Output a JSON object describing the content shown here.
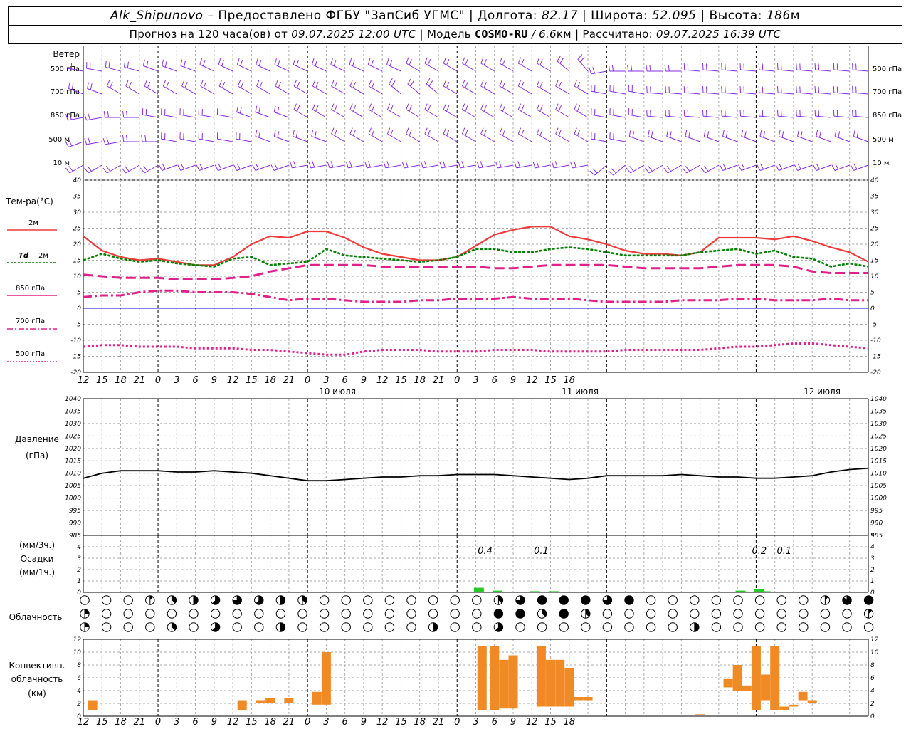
{
  "header": {
    "station": "Alk_Shipunovo",
    "provider": " – Предоставлено ФГБУ \"ЗапСиб УГМС\" | Долгота: ",
    "lon": "82.17",
    "lat_label": " | Широта: ",
    "lat": "52.095",
    "alt_label": " | Высота: ",
    "alt": "186",
    "alt_unit": "м",
    "fc_label": "Прогноз на 120 часа(ов) от ",
    "fc_time": "09.07.2025 12:00 UTC",
    "model_label": " | Модель ",
    "model": "COSMO-RU",
    "model_res": " / 6.6",
    "model_res_unit": "км",
    "calc_label": " | Рассчитано: ",
    "calc_time": "09.07.2025 16:39 UTC"
  },
  "wind_panel": {
    "title": "Ветер",
    "levels": [
      "500 гПа",
      "700 гПа",
      "850 гПа",
      "500 м",
      "10 м"
    ],
    "color": "#8a2be2"
  },
  "hour_ticks": [
    "12",
    "15",
    "18",
    "21",
    "0",
    "3",
    "6",
    "9",
    "12",
    "15",
    "18",
    "21",
    "0",
    "3",
    "6",
    "9",
    "12",
    "15",
    "18",
    "21",
    "0",
    "3",
    "6",
    "9",
    "12",
    "15",
    "18"
  ],
  "day_labels": [
    "10 июля",
    "11 июля",
    "12 июля"
  ],
  "legend": {
    "title": "Тем-ра(°C)",
    "t2m": "2м",
    "td_prefix": "Td",
    "td": "2м",
    "t850": "850 гПа",
    "t700": "700 гПа",
    "t500": "500 гПа"
  },
  "pressure_panel": {
    "title": "Давление",
    "unit": "(гПа)"
  },
  "precip_panel": {
    "unit3": "(мм/3ч.)",
    "title": "Осадки",
    "unit1": "(мм/1ч.)"
  },
  "cloud_panel": {
    "title": "Облачность"
  },
  "conv_panel": {
    "title1": "Конвективн.",
    "title2": "облачность",
    "unit": "(км)"
  },
  "colors": {
    "t2m": "#ee3b3b",
    "td": "#008000",
    "t850": "#e0218a",
    "t700": "#e0218a",
    "t500": "#e0218a",
    "zero": "#0000cd",
    "pressure": "#000000",
    "precip": "#22cc22",
    "conv": "#f08a24"
  },
  "chart_data": [
    {
      "type": "line",
      "title": "Тем-ра(°C)",
      "x_hours": [
        0,
        3,
        6,
        9,
        12,
        15,
        18,
        21,
        24,
        27,
        30,
        33,
        36,
        39,
        42,
        45,
        48,
        51,
        54,
        57,
        60,
        63,
        66,
        69,
        72,
        75,
        78,
        81,
        84,
        87,
        90,
        93,
        96,
        99,
        102,
        105,
        108,
        111,
        114,
        117,
        120,
        123,
        126
      ],
      "ylim": [
        -20,
        40
      ],
      "series": [
        {
          "name": "2м",
          "values": [
            22.5,
            18,
            16,
            15,
            15.5,
            14.5,
            13.5,
            13.5,
            16,
            20,
            22.5,
            22,
            24,
            24,
            22,
            19,
            17,
            16,
            15,
            15,
            16,
            19.5,
            23,
            24.5,
            25.5,
            25.5,
            22.5,
            21.5,
            20,
            18,
            17,
            17,
            16.5,
            17.5,
            22,
            22,
            22,
            21.5,
            22.5,
            21,
            19,
            17.5,
            14.5
          ]
        },
        {
          "name": "Td 2м",
          "values": [
            15,
            17,
            15.5,
            14.5,
            15,
            14,
            13.5,
            13,
            15.5,
            16,
            13.5,
            14,
            14.5,
            18.5,
            16.5,
            16,
            15.5,
            15,
            14.5,
            15,
            16,
            18.5,
            18.5,
            17.5,
            17.5,
            18.5,
            19,
            18.5,
            17.5,
            16.5,
            16.5,
            16.5,
            16.5,
            17.5,
            18,
            18.5,
            17,
            18,
            16,
            15.5,
            13,
            14,
            13
          ]
        },
        {
          "name": "850 гПа",
          "values": [
            10.5,
            10,
            9.5,
            9.5,
            9.5,
            9,
            9,
            9,
            9.5,
            10,
            11.5,
            12.5,
            13.5,
            13.5,
            13.5,
            13.5,
            13,
            13,
            13,
            13,
            13,
            13,
            12.5,
            12.5,
            13,
            13.5,
            13.5,
            13.5,
            13.5,
            13,
            12.5,
            12.5,
            12.5,
            12.5,
            13,
            13.5,
            13.5,
            13.5,
            13,
            11.5,
            11,
            11,
            11
          ]
        },
        {
          "name": "700 гПа",
          "values": [
            3.5,
            4,
            4,
            5,
            5.5,
            5.5,
            5,
            5,
            5,
            4.5,
            3.5,
            2.5,
            3,
            3,
            2.5,
            2,
            2,
            2,
            2.5,
            2.5,
            3,
            3,
            3,
            3.5,
            3,
            3,
            3,
            2.5,
            2,
            2,
            2,
            2,
            2.5,
            2.5,
            2.5,
            3,
            3,
            2.5,
            2.5,
            2.5,
            3,
            2.5,
            2.5
          ]
        },
        {
          "name": "500 гПа",
          "values": [
            -12,
            -11.5,
            -11.5,
            -12,
            -12,
            -12,
            -12.5,
            -12.5,
            -12.5,
            -13,
            -13,
            -13.5,
            -14,
            -14.5,
            -14.5,
            -13.5,
            -13,
            -13,
            -13,
            -13.5,
            -13.5,
            -13.5,
            -13,
            -13,
            -13,
            -13.5,
            -13.5,
            -13.5,
            -13.5,
            -13,
            -13,
            -13,
            -13,
            -13,
            -12.5,
            -12,
            -12,
            -11.5,
            -11,
            -11,
            -11.5,
            -12,
            -12.5
          ]
        }
      ]
    },
    {
      "type": "line",
      "title": "Давление",
      "ylabel": "(гПа)",
      "ylim": [
        985,
        1040
      ],
      "x_hours": [
        0,
        3,
        6,
        9,
        12,
        15,
        18,
        21,
        24,
        27,
        30,
        33,
        36,
        39,
        42,
        45,
        48,
        51,
        54,
        57,
        60,
        63,
        66,
        69,
        72,
        75,
        78,
        81,
        84,
        87,
        90,
        93,
        96,
        99,
        102,
        105,
        108,
        111,
        114,
        117,
        120,
        123,
        126
      ],
      "values": [
        1008,
        1010,
        1011,
        1011,
        1011,
        1010.5,
        1010.5,
        1011,
        1010.5,
        1010,
        1009,
        1008,
        1007,
        1007,
        1007.5,
        1008,
        1008.5,
        1008.5,
        1009,
        1009,
        1009.5,
        1009.5,
        1009.5,
        1009,
        1008.5,
        1008,
        1007.5,
        1008,
        1009,
        1009,
        1009,
        1009,
        1009.5,
        1009,
        1008.5,
        1008.5,
        1008,
        1008,
        1008.5,
        1009,
        1010.5,
        1011.5,
        1012
      ]
    },
    {
      "type": "bar",
      "title": "Осадки",
      "ylabel": "(мм/3ч.)",
      "ylim": [
        0,
        5
      ],
      "x_hours": [
        63.5,
        66.5,
        72.5,
        75.5,
        105.5,
        108.5,
        109.5
      ],
      "values": [
        0.4,
        0.15,
        0.1,
        0.1,
        0.15,
        0.3,
        0.1
      ],
      "annotations": [
        {
          "x_hour": 64.5,
          "text": "0.4"
        },
        {
          "x_hour": 73.5,
          "text": "0.1"
        },
        {
          "x_hour": 108.5,
          "text": "0.2"
        },
        {
          "x_hour": 112.5,
          "text": "0.1"
        }
      ]
    },
    {
      "type": "bar",
      "title": "Конвективн. облачность",
      "ylabel": "(км)",
      "ylim": [
        0,
        13
      ],
      "bars": [
        {
          "x_hour": 1.5,
          "bottom": 1,
          "top": 2.5
        },
        {
          "x_hour": 25.5,
          "bottom": 1,
          "top": 2.5
        },
        {
          "x_hour": 28.5,
          "bottom": 2,
          "top": 2.5
        },
        {
          "x_hour": 30,
          "bottom": 2,
          "top": 2.8
        },
        {
          "x_hour": 33,
          "bottom": 2,
          "top": 2.8
        },
        {
          "x_hour": 37.5,
          "bottom": 1.8,
          "top": 3.8
        },
        {
          "x_hour": 39,
          "bottom": 1.8,
          "top": 10
        },
        {
          "x_hour": 64,
          "bottom": 1,
          "top": 11
        },
        {
          "x_hour": 66,
          "bottom": 1,
          "top": 11
        },
        {
          "x_hour": 67.5,
          "bottom": 1.2,
          "top": 8.8
        },
        {
          "x_hour": 69,
          "bottom": 1.2,
          "top": 9.5
        },
        {
          "x_hour": 73.5,
          "bottom": 1.5,
          "top": 11
        },
        {
          "x_hour": 75,
          "bottom": 1.5,
          "top": 8.8
        },
        {
          "x_hour": 76.5,
          "bottom": 1.5,
          "top": 8.8
        },
        {
          "x_hour": 78,
          "bottom": 1.5,
          "top": 7.5
        },
        {
          "x_hour": 79.5,
          "bottom": 2.5,
          "top": 3
        },
        {
          "x_hour": 81,
          "bottom": 2.5,
          "top": 3
        },
        {
          "x_hour": 99,
          "bottom": 0.2,
          "top": 0.3
        },
        {
          "x_hour": 103.5,
          "bottom": 4.5,
          "top": 5.8
        },
        {
          "x_hour": 105,
          "bottom": 4,
          "top": 8
        },
        {
          "x_hour": 106.5,
          "bottom": 4,
          "top": 4.8
        },
        {
          "x_hour": 108,
          "bottom": 1,
          "top": 11
        },
        {
          "x_hour": 109.5,
          "bottom": 2.5,
          "top": 6.5
        },
        {
          "x_hour": 111,
          "bottom": 1,
          "top": 11
        },
        {
          "x_hour": 112.5,
          "bottom": 1,
          "top": 1.5
        },
        {
          "x_hour": 114,
          "bottom": 1.5,
          "top": 1.8
        },
        {
          "x_hour": 115.5,
          "bottom": 2.5,
          "top": 3.8
        },
        {
          "x_hour": 117,
          "bottom": 2,
          "top": 2.5
        }
      ]
    },
    {
      "type": "table",
      "title": "Облачность",
      "rows": [
        "00013456543000000003688868000000001788888886654438888788884200001388888887620000000",
        "20000000000000000008838300000000000018580878888876580001888885001888888874000000000",
        "20003050040000004005000000004000000003000804000004000000000440000000000000000000000"
      ]
    },
    {
      "type": "scatter",
      "title": "Ветер",
      "levels": [
        "500 гПа",
        "700 гПа",
        "850 гПа",
        "500 м",
        "10 м"
      ],
      "x_hours": [
        0,
        3,
        6,
        9,
        12,
        15,
        18,
        21,
        24,
        27,
        30,
        33,
        36,
        39,
        42,
        45,
        48,
        51,
        54,
        57,
        60,
        63,
        66,
        69,
        72,
        75,
        78,
        81,
        84,
        87,
        90,
        93,
        96,
        99,
        102,
        105,
        108,
        111,
        114,
        117,
        120,
        123,
        126
      ],
      "direction_deg": [
        [
          280,
          280,
          285,
          285,
          290,
          290,
          290,
          295,
          295,
          295,
          295,
          295,
          295,
          295,
          295,
          295,
          295,
          295,
          300,
          300,
          300,
          300,
          300,
          300,
          300,
          300,
          310,
          320,
          260,
          270,
          270,
          270,
          270,
          275,
          275,
          275,
          275,
          275,
          275,
          275,
          275,
          275,
          275
        ],
        [
          290,
          290,
          300,
          300,
          300,
          300,
          300,
          300,
          300,
          300,
          300,
          300,
          300,
          300,
          300,
          300,
          300,
          310,
          310,
          310,
          300,
          300,
          300,
          300,
          300,
          300,
          300,
          300,
          280,
          280,
          280,
          275,
          275,
          275,
          275,
          275,
          275,
          275,
          275,
          275,
          275,
          275,
          275
        ],
        [
          260,
          260,
          270,
          270,
          280,
          280,
          280,
          280,
          280,
          290,
          290,
          290,
          300,
          300,
          300,
          300,
          300,
          300,
          300,
          300,
          300,
          300,
          300,
          300,
          300,
          300,
          300,
          300,
          280,
          280,
          280,
          275,
          275,
          275,
          275,
          275,
          275,
          275,
          275,
          275,
          275,
          275,
          275
        ],
        [
          250,
          260,
          260,
          270,
          270,
          280,
          280,
          280,
          280,
          280,
          290,
          290,
          290,
          290,
          300,
          300,
          300,
          300,
          300,
          300,
          300,
          300,
          300,
          300,
          300,
          300,
          300,
          300,
          280,
          280,
          290,
          290,
          290,
          290,
          290,
          290,
          290,
          290,
          290,
          290,
          290,
          290,
          290
        ],
        [
          240,
          240,
          240,
          240,
          240,
          250,
          250,
          250,
          250,
          250,
          250,
          250,
          260,
          260,
          260,
          260,
          260,
          260,
          260,
          260,
          260,
          260,
          260,
          260,
          260,
          260,
          260,
          260,
          230,
          230,
          240,
          240,
          240,
          240,
          240,
          250,
          250,
          250,
          250,
          250,
          250,
          250,
          250
        ]
      ]
    }
  ]
}
